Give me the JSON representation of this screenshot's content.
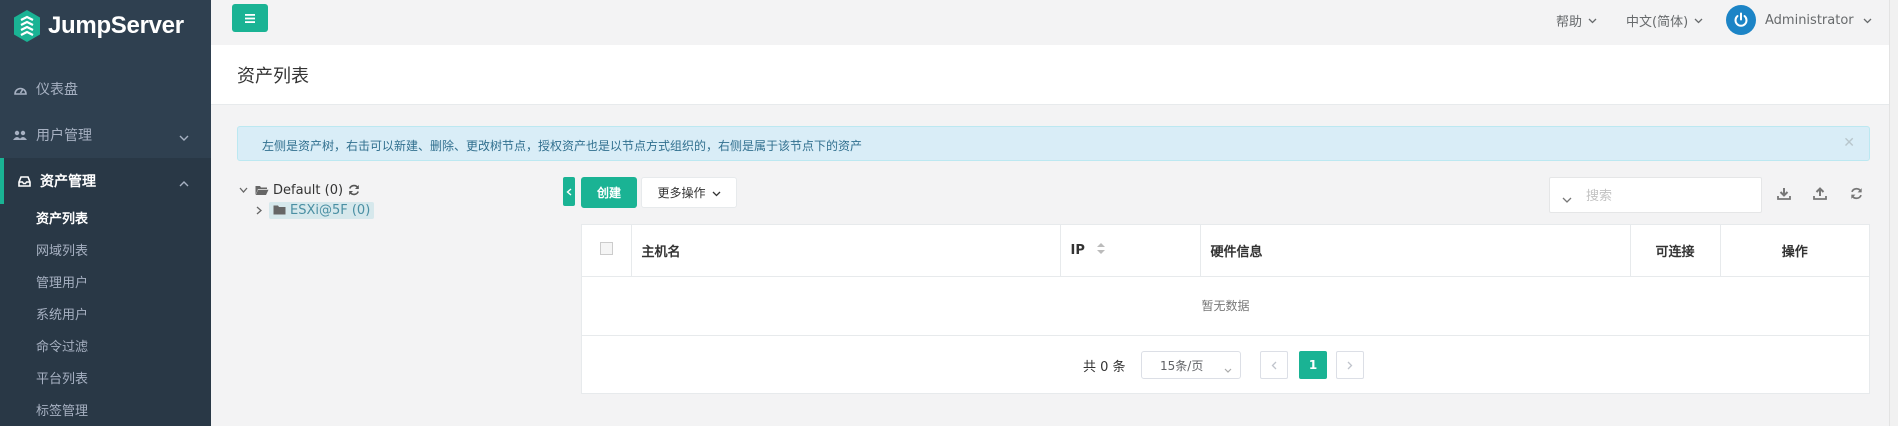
{
  "app": {
    "logo_text": "JumpServer"
  },
  "sidebar": {
    "items": [
      {
        "label": "仪表盘",
        "icon": "dashboard-icon"
      },
      {
        "label": "用户管理",
        "icon": "users-icon"
      },
      {
        "label": "资产管理",
        "icon": "inbox-icon"
      }
    ],
    "sub_items": [
      "资产列表",
      "网域列表",
      "管理用户",
      "系统用户",
      "命令过滤",
      "平台列表",
      "标签管理"
    ]
  },
  "topbar": {
    "help": "帮助",
    "language": "中文(简体)",
    "user": "Administrator"
  },
  "page": {
    "title": "资产列表"
  },
  "alert": {
    "text": "左侧是资产树，右击可以新建、删除、更改树节点，授权资产也是以节点方式组织的，右侧是属于该节点下的资产"
  },
  "tree": {
    "root": "Default (0)",
    "child": "ESXi@5F (0)"
  },
  "toolbar": {
    "create": "创建",
    "more_actions": "更多操作",
    "search_placeholder": "搜索"
  },
  "table": {
    "columns": [
      "主机名",
      "IP",
      "硬件信息",
      "可连接",
      "操作"
    ],
    "empty_text": "暂无数据"
  },
  "pagination": {
    "total": "共 0 条",
    "page_size": "15条/页",
    "current_page": "1"
  },
  "colors": {
    "accent": "#1ab394",
    "sidebar": "#2f4050",
    "avatar": "#1c84c6",
    "alert_bg": "#d9edf7"
  }
}
